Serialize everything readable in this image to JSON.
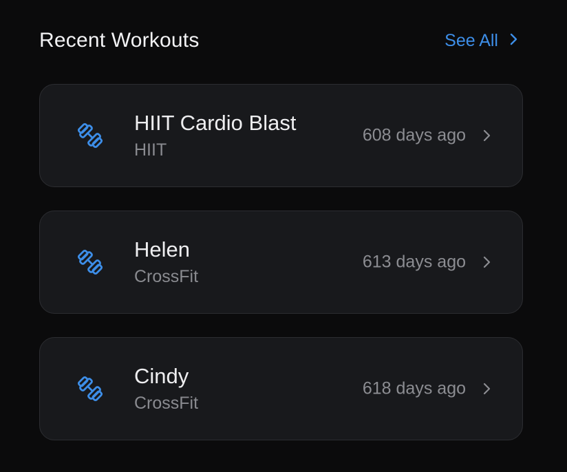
{
  "header": {
    "title": "Recent Workouts",
    "see_all_label": "See All",
    "see_all_icon": "chevron-right-icon"
  },
  "colors": {
    "accent": "#3d8ee8",
    "background": "#0b0b0c",
    "card": "#18191c",
    "text_primary": "#eeeef0",
    "text_secondary": "#8a8b90"
  },
  "workouts": [
    {
      "name": "HIIT Cardio Blast",
      "type": "HIIT",
      "ago": "608 days ago",
      "icon": "dumbbell-icon"
    },
    {
      "name": "Helen",
      "type": "CrossFit",
      "ago": "613 days ago",
      "icon": "dumbbell-icon"
    },
    {
      "name": "Cindy",
      "type": "CrossFit",
      "ago": "618 days ago",
      "icon": "dumbbell-icon"
    }
  ]
}
